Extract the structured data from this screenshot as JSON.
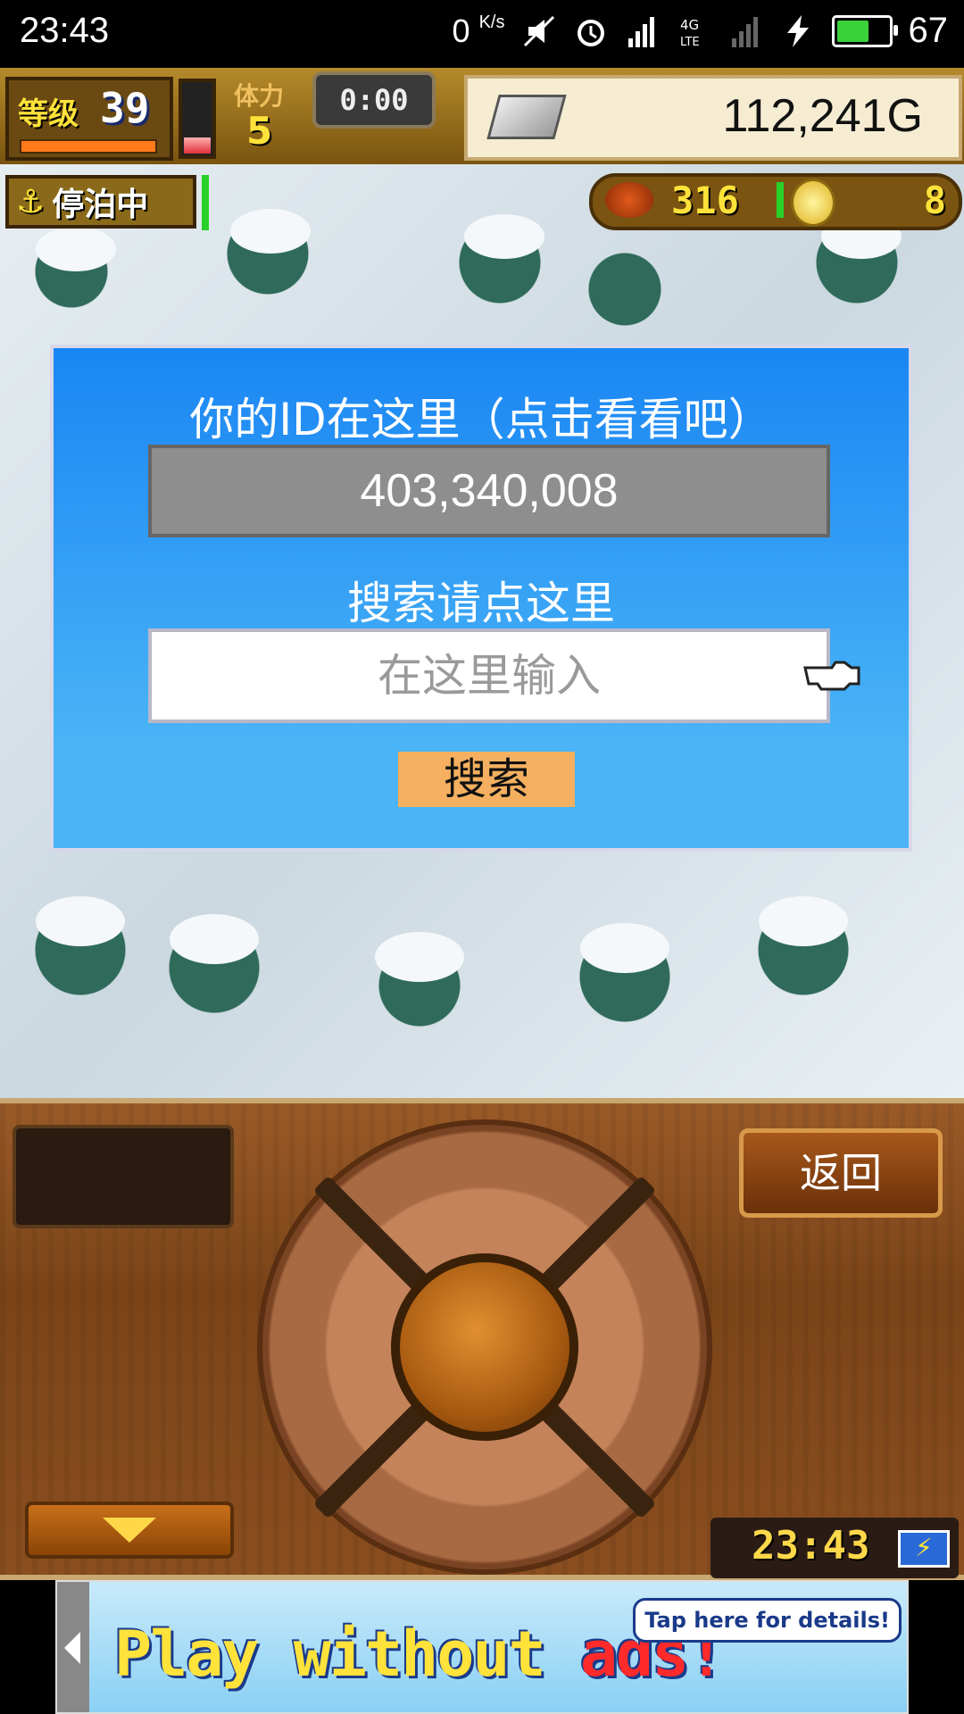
{
  "status_bar": {
    "time": "23:43",
    "net_speed": "0",
    "net_unit": "K/s",
    "battery_level": "67",
    "battery_fraction": 0.67,
    "icons": [
      "mute-icon",
      "alarm-icon",
      "signal-icon",
      "lte-icon",
      "no-signal-icon",
      "charging-icon",
      "battery-icon"
    ]
  },
  "hud": {
    "level_label": "等级",
    "level": "39",
    "stamina_label": "体力",
    "stamina": "5",
    "timer": "0:00",
    "gold": "112,241G",
    "anchor_label": "停泊中",
    "meat": "316",
    "coins": "8"
  },
  "dialog": {
    "title": "你的ID在这里（点击看看吧）",
    "id_value": "403,340,008",
    "search_label": "搜索请点这里",
    "search_placeholder": "在这里输入",
    "search_button": "搜索"
  },
  "controller": {
    "back_button": "返回",
    "clock": "23:43"
  },
  "ad": {
    "text_main": "Play without ",
    "text_accent": "ads!",
    "bubble": "Tap here for details!"
  },
  "colors": {
    "dialog_blue": "#1a86f4",
    "search_button": "#f4b060",
    "gold_text": "#ffe23a"
  }
}
